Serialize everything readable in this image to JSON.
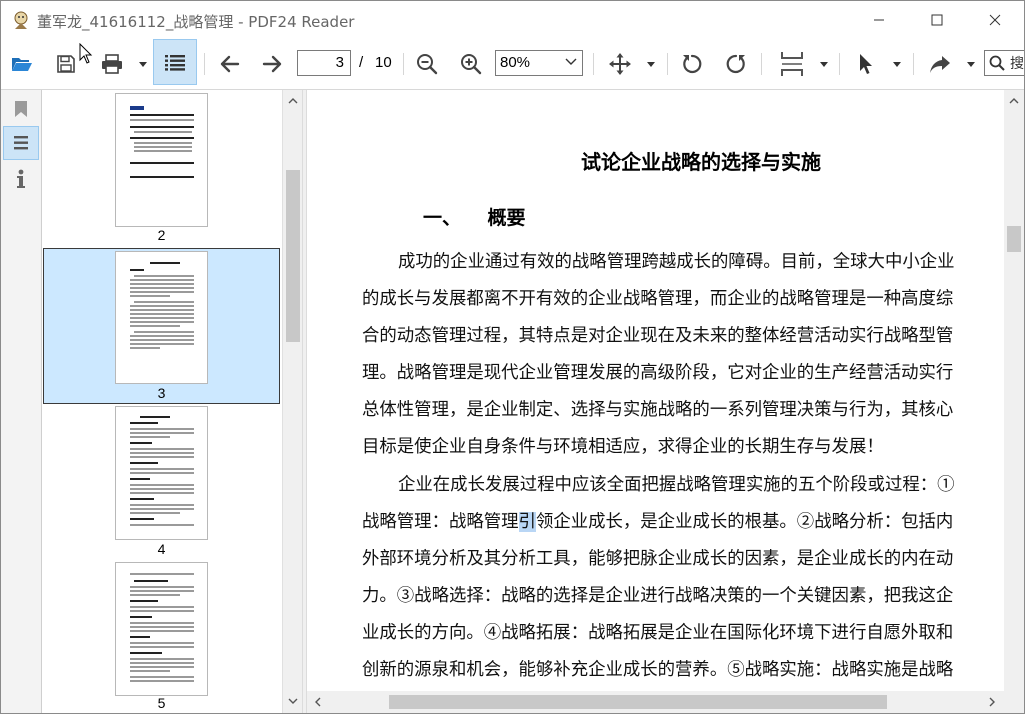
{
  "window": {
    "title": "董军龙_41616112_战略管理 - PDF24 Reader"
  },
  "toolbar": {
    "current_page": "3",
    "page_separator": "/",
    "total_pages": "10",
    "zoom": "80%",
    "search_placeholder": "搜"
  },
  "thumbnails": [
    {
      "label": "2",
      "selected": false
    },
    {
      "label": "3",
      "selected": true
    },
    {
      "label": "4",
      "selected": false
    },
    {
      "label": "5",
      "selected": false
    }
  ],
  "document": {
    "title": "试论企业战略的选择与实施",
    "heading": "一、    概要",
    "lines": [
      "成功的企业通过有效的战略管理跨越成长的障碍。目前，全球大中小企业",
      "的成长与发展都离不开有效的企业战略管理，而企业的战略管理是一种高度综",
      "合的动态管理过程，其特点是对企业现在及未来的整体经营活动实行战略型管",
      "理。战略管理是现代企业管理发展的高级阶段，它对企业的生产经营活动实行",
      "总体性管理，是企业制定、选择与实施战略的一系列管理决策与行为，其核心",
      "目标是使企业自身条件与环境相适应，求得企业的长期生存与发展！",
      "企业在成长发展过程中应该全面把握战略管理实施的五个阶段或过程：①",
      "战略管理：战略管理",
      "引",
      "领企业成长，是企业成长的根基。②战略分析：包括内",
      "外部环境分析及其分析工具，能够把脉企业成长的因素，是企业成长的内在动",
      "力。③战略选择：战略的选择是企业进行战略决策的一个关键因素，把我这企",
      "业成长的方向。④战略拓展：战略拓展是企业在国际化环境下进行自愿外取和",
      "创新的源泉和机会，能够补充企业成长的营养。⑤战略实施：战略实施是战略"
    ]
  },
  "colors": {
    "selection": "#cce8ff",
    "toolbar_active": "#cce4f7",
    "text_selection": "#b9d6f5"
  }
}
